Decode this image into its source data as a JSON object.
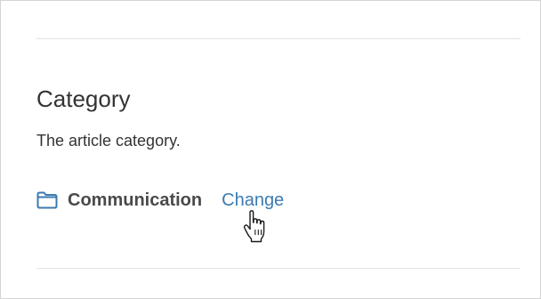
{
  "section": {
    "heading": "Category",
    "description": "The article category."
  },
  "category": {
    "icon": "folder-icon",
    "name": "Communication",
    "change_label": "Change"
  },
  "colors": {
    "text": "#333333",
    "link": "#3c7ab0",
    "icon": "#3c7ab0",
    "divider": "#e2e2e2"
  },
  "cursor": {
    "icon": "hand-pointer-icon"
  }
}
